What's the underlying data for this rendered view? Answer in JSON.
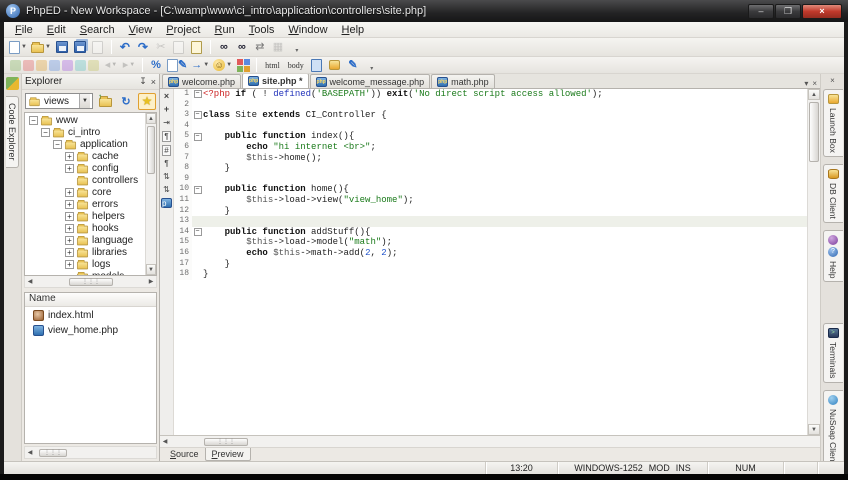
{
  "window": {
    "title": "PhpED - New Workspace - [C:\\wamp\\www\\ci_intro\\application\\controllers\\site.php]",
    "controls": {
      "minimize": "–",
      "maximize": "❐",
      "close": "×"
    }
  },
  "menu_bar": {
    "items": [
      "File",
      "Edit",
      "Search",
      "View",
      "Project",
      "Run",
      "Tools",
      "Window",
      "Help"
    ]
  },
  "toolbars": {
    "row1": [
      {
        "name": "new-file-button",
        "icon": "page-new",
        "dd": true
      },
      {
        "name": "open-file-button",
        "icon": "folder-open",
        "dd": true
      },
      {
        "name": "save-button",
        "icon": "floppy"
      },
      {
        "name": "save-all-button",
        "icon": "floppy-multi"
      },
      {
        "name": "print-button",
        "icon": "page-gray",
        "disabled": true
      },
      {
        "sep": true
      },
      {
        "name": "undo-button",
        "icon": "undo"
      },
      {
        "name": "redo-button",
        "icon": "redo"
      },
      {
        "name": "cut-button",
        "icon": "cut",
        "disabled": true
      },
      {
        "name": "copy-button",
        "icon": "copy",
        "disabled": true
      },
      {
        "name": "paste-button",
        "icon": "paste"
      },
      {
        "sep": true
      },
      {
        "name": "find-button",
        "icon": "binoculars"
      },
      {
        "name": "find-in-files-button",
        "icon": "binoculars"
      },
      {
        "name": "replace-button",
        "icon": "replace"
      },
      {
        "name": "window-grid-button",
        "icon": "grid",
        "disabled": true
      },
      {
        "name": "toolbar-overflow",
        "icon": "overflow"
      }
    ],
    "row2": [
      {
        "name": "run-debug-group",
        "icon": "ghost-group"
      },
      {
        "name": "back-button",
        "icon": "back",
        "disabled": true,
        "dd": true
      },
      {
        "name": "forward-button",
        "icon": "forward",
        "disabled": true,
        "dd": true
      },
      {
        "sep": true
      },
      {
        "name": "code-tools-button",
        "icon": "percent"
      },
      {
        "name": "edit-page-button",
        "icon": "page-edit"
      },
      {
        "name": "goto-button",
        "icon": "go-arrow",
        "dd": true
      },
      {
        "name": "accounts-button",
        "icon": "user",
        "dd": true
      },
      {
        "name": "palette-button",
        "icon": "palette"
      },
      {
        "sep": true
      },
      {
        "name": "html-tag-button",
        "label": "html"
      },
      {
        "name": "body-tag-button",
        "label": "body"
      },
      {
        "name": "page-props-button",
        "icon": "page-blue"
      },
      {
        "name": "image-button",
        "icon": "box-yellow"
      },
      {
        "name": "style-pen-button",
        "icon": "pen"
      },
      {
        "name": "toolbar-overflow",
        "icon": "overflow"
      }
    ]
  },
  "left_strip": {
    "vertical_tab": "Code Explorer"
  },
  "explorer": {
    "title": "Explorer",
    "combo_value": "views",
    "buttons": [
      {
        "name": "folder-up-button"
      },
      {
        "name": "refresh-button"
      },
      {
        "name": "favorites-button",
        "active": true
      }
    ],
    "tree": [
      {
        "label": "www",
        "level": 1,
        "expander": "minus"
      },
      {
        "label": "ci_intro",
        "level": 2,
        "expander": "minus"
      },
      {
        "label": "application",
        "level": 3,
        "expander": "minus"
      },
      {
        "label": "cache",
        "level": 4,
        "expander": "plus"
      },
      {
        "label": "config",
        "level": 4,
        "expander": "plus"
      },
      {
        "label": "controllers",
        "level": 4,
        "expander": "none"
      },
      {
        "label": "core",
        "level": 4,
        "expander": "plus"
      },
      {
        "label": "errors",
        "level": 4,
        "expander": "plus"
      },
      {
        "label": "helpers",
        "level": 4,
        "expander": "plus"
      },
      {
        "label": "hooks",
        "level": 4,
        "expander": "plus"
      },
      {
        "label": "language",
        "level": 4,
        "expander": "plus"
      },
      {
        "label": "libraries",
        "level": 4,
        "expander": "plus"
      },
      {
        "label": "logs",
        "level": 4,
        "expander": "plus"
      },
      {
        "label": "models",
        "level": 4,
        "expander": "none"
      }
    ]
  },
  "files_panel": {
    "header": "Name",
    "items": [
      {
        "name": "index.html",
        "icon": "html-file-icon"
      },
      {
        "name": "view_home.php",
        "icon": "php-file-icon"
      }
    ]
  },
  "editor": {
    "tabs": [
      {
        "label": "welcome.php",
        "active": false
      },
      {
        "label": "site.php *",
        "active": true
      },
      {
        "label": "welcome_message.php",
        "active": false
      },
      {
        "label": "math.php",
        "active": false
      }
    ],
    "current_line": 13,
    "gutter_icons": [
      {
        "name": "close-icon",
        "glyph": "×",
        "style": "bold"
      },
      {
        "name": "add-bookmark-icon",
        "glyph": "+",
        "style": "bold"
      },
      {
        "name": "jump-icon",
        "glyph": "⇥"
      },
      {
        "name": "pilcrow-boxed-icon",
        "glyph": "¶",
        "style": "boxed"
      },
      {
        "name": "hash-boxed-icon",
        "glyph": "#",
        "style": "boxed"
      },
      {
        "name": "pilcrow-icon",
        "glyph": "¶"
      },
      {
        "name": "sort-icon",
        "glyph": "⇅"
      },
      {
        "name": "indent-icon",
        "glyph": "⇅"
      },
      {
        "name": "php-page-icon",
        "glyph": "p",
        "style": "blue"
      }
    ],
    "lines": [
      {
        "n": 1,
        "fold": true,
        "t": [
          [
            "<?php ",
            "tag"
          ],
          [
            "if ",
            "kw"
          ],
          [
            "( ! ",
            "pln"
          ],
          [
            "defined",
            "fn"
          ],
          [
            "(",
            "pln"
          ],
          [
            "'BASEPATH'",
            "str"
          ],
          [
            ")) ",
            "pln"
          ],
          [
            "exit",
            "kw"
          ],
          [
            "(",
            "pln"
          ],
          [
            "'No direct script access allowed'",
            "str"
          ],
          [
            ");",
            "pln"
          ]
        ]
      },
      {
        "n": 2,
        "t": []
      },
      {
        "n": 3,
        "fold": true,
        "t": [
          [
            "class ",
            "kw"
          ],
          [
            "Site ",
            "pln"
          ],
          [
            "extends ",
            "kw"
          ],
          [
            "CI_Controller {",
            "pln"
          ]
        ]
      },
      {
        "n": 4,
        "t": []
      },
      {
        "n": 5,
        "fold": true,
        "t": [
          [
            "    ",
            "pln"
          ],
          [
            "public function ",
            "kw"
          ],
          [
            "index(){",
            "pln"
          ]
        ]
      },
      {
        "n": 6,
        "t": [
          [
            "        ",
            "pln"
          ],
          [
            "echo ",
            "kw"
          ],
          [
            "\"hi internet <br>\"",
            "str"
          ],
          [
            ";",
            "pln"
          ]
        ]
      },
      {
        "n": 7,
        "t": [
          [
            "        ",
            "pln"
          ],
          [
            "$this",
            "var"
          ],
          [
            "->home();",
            "pln"
          ]
        ]
      },
      {
        "n": 8,
        "t": [
          [
            "    }",
            "pln"
          ]
        ]
      },
      {
        "n": 9,
        "t": []
      },
      {
        "n": 10,
        "fold": true,
        "t": [
          [
            "    ",
            "pln"
          ],
          [
            "public function ",
            "kw"
          ],
          [
            "home(){",
            "pln"
          ]
        ]
      },
      {
        "n": 11,
        "t": [
          [
            "        ",
            "pln"
          ],
          [
            "$this",
            "var"
          ],
          [
            "->load->view(",
            "pln"
          ],
          [
            "\"view_home\"",
            "str"
          ],
          [
            ");",
            "pln"
          ]
        ]
      },
      {
        "n": 12,
        "t": [
          [
            "    }",
            "pln"
          ]
        ]
      },
      {
        "n": 13,
        "t": []
      },
      {
        "n": 14,
        "fold": true,
        "t": [
          [
            "    ",
            "pln"
          ],
          [
            "public function ",
            "kw"
          ],
          [
            "addStuff(){",
            "pln"
          ]
        ]
      },
      {
        "n": 15,
        "t": [
          [
            "        ",
            "pln"
          ],
          [
            "$this",
            "var"
          ],
          [
            "->load->model(",
            "pln"
          ],
          [
            "\"math\"",
            "str"
          ],
          [
            ");",
            "pln"
          ]
        ]
      },
      {
        "n": 16,
        "t": [
          [
            "        ",
            "pln"
          ],
          [
            "echo ",
            "kw"
          ],
          [
            "$this",
            "var"
          ],
          [
            "->math->add(",
            "pln"
          ],
          [
            "2",
            "num"
          ],
          [
            ", ",
            "pln"
          ],
          [
            "2",
            "num"
          ],
          [
            ");",
            "pln"
          ]
        ]
      },
      {
        "n": 17,
        "t": [
          [
            "    }",
            "pln"
          ]
        ]
      },
      {
        "n": 18,
        "t": [
          [
            "}",
            "pln"
          ]
        ]
      }
    ]
  },
  "bottom_tabs": {
    "items": [
      {
        "label": "Source",
        "active": true
      },
      {
        "label": "Preview",
        "active": false
      }
    ]
  },
  "right_panel": {
    "tabs": [
      {
        "label": "Launch Box",
        "icons": [
          "launchbox-icon"
        ]
      },
      {
        "label": "DB Client",
        "icons": [
          "db-icon"
        ]
      },
      {
        "label": "Help",
        "icons": [
          "debug-icon",
          "help-icon"
        ]
      },
      {
        "label": "Terminals",
        "icons": [
          "terminal-icon"
        ],
        "gap_before": true
      },
      {
        "label": "NuSoap Client",
        "icons": [
          "nusoap-icon"
        ]
      }
    ]
  },
  "status_bar": {
    "time": "13:20",
    "encoding": "WINDOWS-1252",
    "modified": "MOD",
    "insert_mode": "INS",
    "numlock": "NUM"
  },
  "colors": {
    "accent_blue": "#2f6fb0",
    "string_green": "#1a7a1a",
    "tag_red": "#cc2222",
    "folder_yellow": "#e9c254",
    "close_red": "#c0392b"
  }
}
